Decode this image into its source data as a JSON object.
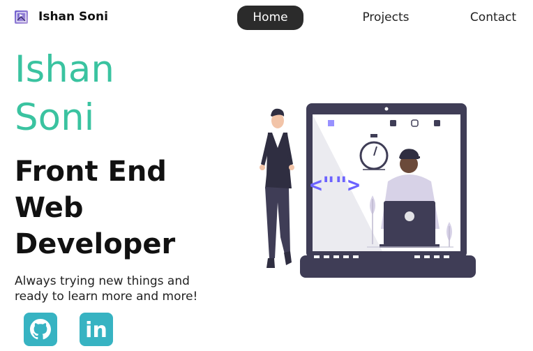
{
  "brand": {
    "name": "Ishan Soni",
    "logo_icon": "portrait-logo-icon"
  },
  "nav": {
    "items": [
      {
        "label": "Home",
        "active": true
      },
      {
        "label": "Projects",
        "active": false
      },
      {
        "label": "Contact",
        "active": false
      }
    ]
  },
  "hero": {
    "name_line1": "Ishan",
    "name_line2": "Soni",
    "role_line1": "Front End",
    "role_line2": "Web",
    "role_line3": "Developer",
    "tagline_line1": "Always trying new things and",
    "tagline_line2": "ready to learn more and more!"
  },
  "social": [
    {
      "icon": "github-icon"
    },
    {
      "icon": "linkedin-icon",
      "text": "in"
    }
  ],
  "colors": {
    "accent_teal": "#3ac3a0",
    "nav_active_bg": "#2b2b2b",
    "social_bg": "#37b3c2",
    "illustration_dark": "#3f3d56",
    "code_purple": "#6c63ff"
  },
  "illustration": {
    "code_glyph": "<\"\">"
  }
}
